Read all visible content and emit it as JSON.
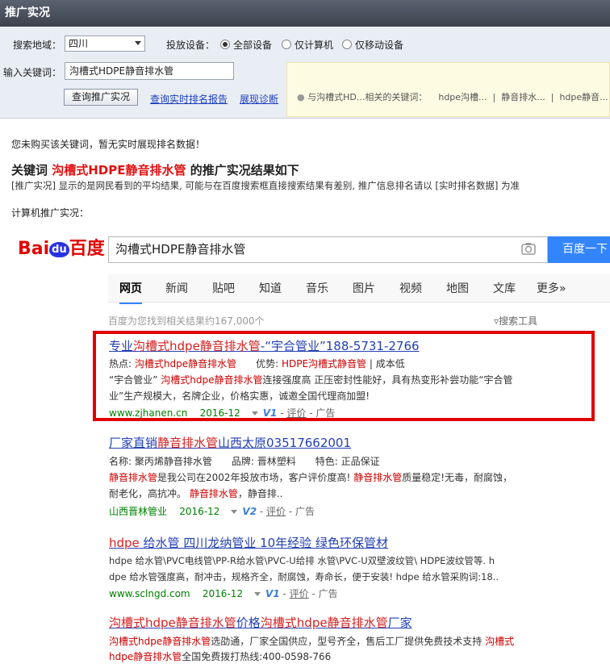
{
  "header": {
    "title": "推广实况"
  },
  "form": {
    "region_label": "搜索地域：",
    "region_value": "四川",
    "device_label": "投放设备：",
    "device_options": [
      "全部设备",
      "仅计算机",
      "仅移动设备"
    ],
    "keyword_label": "输入关键词：",
    "keyword_value": "沟槽式HDPE静音排水管",
    "query_button": "查询推广实况",
    "link_realtime": "查询实时排名报告",
    "link_diagnose": "展现诊断",
    "tip_text": "与沟槽式HD...相关的关键词：",
    "related": [
      "hdpe沟槽...",
      "静音排水...",
      "hdpe静音..."
    ]
  },
  "notice": "您未购买该关键词，暂无实时展现排名数据！",
  "heading": {
    "prefix": "关键词 ",
    "keyword": "沟槽式HDPE静音排水管",
    "suffix": " 的推广实况结果如下"
  },
  "desc": "[推广实况] 显示的是网民看到的平均结果, 可能与在百度搜索框直接搜索结果有差别, 推广信息排名请以 [实时排名数据] 为准",
  "pc_label": "计算机推广实况：",
  "baidu": {
    "logo": "Bai百度",
    "logo_bai": "Bai",
    "logo_du": "du",
    "logo_cn": "百度",
    "query": "沟槽式HDPE静音排水管",
    "button": "百度一下",
    "tabs": [
      "网页",
      "新闻",
      "贴吧",
      "知道",
      "音乐",
      "图片",
      "视频",
      "地图",
      "文库",
      "更多»"
    ],
    "count": "百度为您找到相关结果约167,000个",
    "tools": "搜索工具"
  },
  "results": [
    {
      "t1": "专业",
      "t2": "沟槽式hdpe静音排水管",
      "t3": "-“宇合管业”188-5731-2766",
      "l1a": "热点: ",
      "l1b": "沟槽式hdpe静音排水管",
      "l1c": "　　优势: ",
      "l1d": "HDPE沟槽式静音管",
      "l1e": " | 成本低",
      "l2a": "“宇合管业” ",
      "l2b": "沟槽式hdpe静音排水管",
      "l2c": "连接强度高 正压密封性能好，具有热变形补尝功能“宇合管",
      "l3": "业”生产规模大，名牌企业，价格实惠，诚邀全国代理商加盟!",
      "url": "www.zjhanen.cn",
      "date": "2016-12",
      "v": "V1",
      "eval": "评价",
      "ad": "广告"
    },
    {
      "t1": "厂家直销",
      "t2": "静音排水管",
      "t3": "山西太原03517662001",
      "l1": "名称: 聚丙烯静音排水管　　品牌: 晋林塑料　　特色: 正品保证",
      "l2a": "静音排水管",
      "l2b": "是我公司在2002年投放市场，客户评价度高! ",
      "l2c": "静音排水管",
      "l2d": "质量稳定!无毒，耐腐蚀，",
      "l3a": "耐老化，高抗冲。 ",
      "l3b": "静音排水管",
      "l3c": "，静音排..",
      "url": "山西晋林管业",
      "date": "2016-12",
      "v": "V2",
      "eval": "评价",
      "ad": "广告"
    },
    {
      "t1": "hdpe",
      "t2": " 给水管 四川龙纳管业 10年经验 绿色环保管材",
      "l2": "hdpe 给水管\\PVC电线管\\PP-R给水管\\PVC-U给排 水管\\PVC-U双壁波纹管\\ HDPE波纹管等. h",
      "l3": "dpe 给水管强度高，耐冲击，规格齐全，耐腐蚀，寿命长，便于安装! hdpe 给水管采购词:18..",
      "url": "www.sclngd.com",
      "date": "2016-12",
      "v": "V1",
      "eval": "评价",
      "ad": "广告"
    },
    {
      "t1": "沟槽式hdpe静音排水管",
      "t2": "价格",
      "t3": "沟槽式hdpe静音排水管",
      "t4": "厂家",
      "l2a": "沟槽式hdpe静音排水管",
      "l2b": "选劭通，厂家全国供应，型号齐全，售后工厂提供免费技术支持 ",
      "l2c": "沟槽式",
      "l3a": "hdpe静音排水管",
      "l3b": "全国免费拨打热线:400-0598-766"
    }
  ]
}
